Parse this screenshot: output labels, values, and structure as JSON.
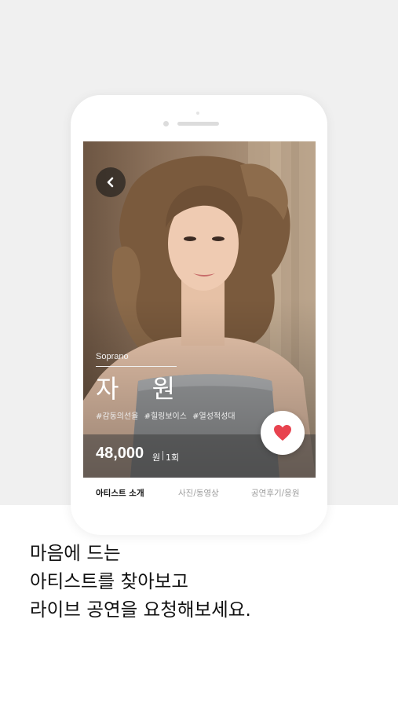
{
  "artist": {
    "role": "Soprano",
    "name": "자 원",
    "tags": [
      "#감동의선율",
      "#힐링보이스",
      "#열성적성대"
    ],
    "price": "48,000",
    "price_unit": "원",
    "count_label": "1회"
  },
  "tabs": [
    {
      "label": "아티스트 소개",
      "active": true
    },
    {
      "label": "사진/동영상",
      "active": false
    },
    {
      "label": "공연후기/응원",
      "active": false
    }
  ],
  "headline": [
    "마음에 드는",
    "아티스트를 찾아보고",
    "라이브 공연을 요청해보세요."
  ],
  "icons": {
    "back": "chevron-left-icon",
    "like": "heart-icon"
  },
  "colors": {
    "heart": "#e8434f",
    "background": "#f0f0f0",
    "text": "#111111"
  }
}
